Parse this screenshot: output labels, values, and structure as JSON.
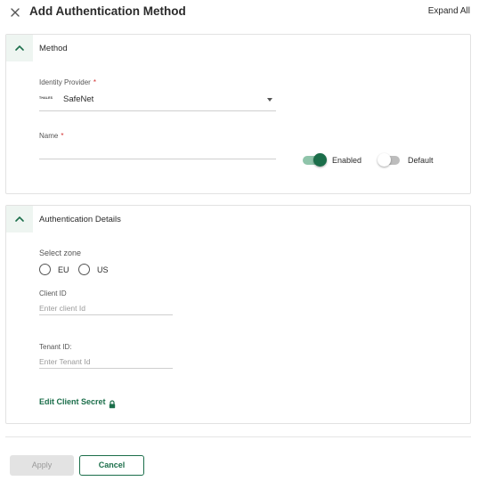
{
  "header": {
    "title": "Add Authentication Method",
    "expand_all": "Expand All"
  },
  "method": {
    "section_title": "Method",
    "identity_provider_label": "Identity Provider",
    "required_mark": "*",
    "identity_provider_value": "SafeNet",
    "identity_provider_logo_text": "THALES",
    "name_label": "Name",
    "name_value": "",
    "enabled_label": "Enabled",
    "enabled_on": true,
    "default_label": "Default",
    "default_on": false
  },
  "auth_details": {
    "section_title": "Authentication Details",
    "select_zone_label": "Select zone",
    "zones": [
      "EU",
      "US"
    ],
    "client_id_label": "Client ID",
    "client_id_placeholder": "Enter client Id",
    "tenant_id_label": "Tenant ID:",
    "tenant_id_placeholder": "Enter Tenant Id",
    "edit_secret_label": "Edit Client Secret"
  },
  "footer": {
    "apply_label": "Apply",
    "cancel_label": "Cancel"
  },
  "icons": {
    "close": "close-icon",
    "chevron": "chevron-up-icon",
    "caret": "caret-down-icon",
    "lock": "lock-icon"
  },
  "colors": {
    "accent": "#1b6e4a",
    "toggle_on_track": "#8fc4aa",
    "toggle_off_track": "#bdbdbd",
    "required": "#d32f2f",
    "disabled_button": "#e3e3e3"
  }
}
